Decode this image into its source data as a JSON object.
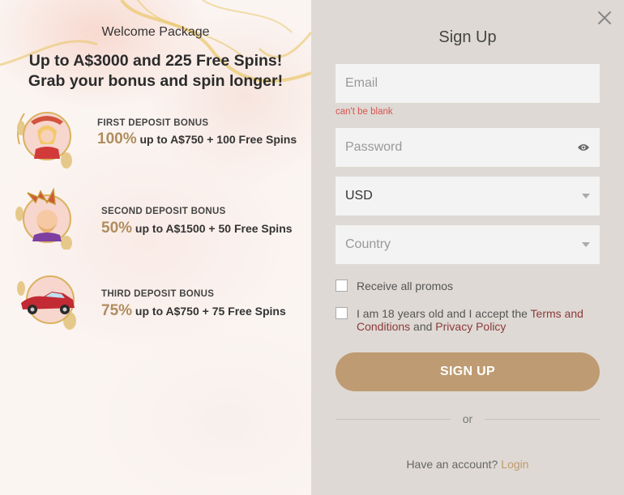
{
  "welcome": {
    "title": "Welcome Package",
    "headline_line1": "Up to A$3000 and 225 Free Spins!",
    "headline_line2": "Grab your bonus and spin longer!"
  },
  "bonuses": [
    {
      "name": "FIRST DEPOSIT BONUS",
      "percent": "100%",
      "text": " up to A$750 + 100 Free Spins"
    },
    {
      "name": "SECOND DEPOSIT BONUS",
      "percent": "50%",
      "text": " up to A$1500 + 50 Free Spins"
    },
    {
      "name": "THIRD DEPOSIT BONUS",
      "percent": "75%",
      "text": " up to A$750 + 75 Free Spins"
    }
  ],
  "signup": {
    "title": "Sign Up",
    "email_placeholder": "Email",
    "email_error": "can't be blank",
    "password_placeholder": "Password",
    "currency_value": "USD",
    "country_placeholder": "Country",
    "promos_label": "Receive all promos",
    "terms_prefix": "I am 18 years old and I accept the ",
    "terms_link": "Terms and Conditions",
    "terms_middle": " and ",
    "privacy_link": "Privacy Policy",
    "button_label": "SIGN UP",
    "or_text": "or",
    "have_account": "Have an account?",
    "login_link": "Login"
  },
  "colors": {
    "accent_gold": "#be9b72",
    "right_panel_bg": "#ded9d4",
    "error_red": "#d9534f",
    "link_red": "#8b3a3a"
  },
  "icons": {
    "close": "close-icon",
    "password_toggle": "eye-icon",
    "dropdown": "caret-down-icon"
  }
}
